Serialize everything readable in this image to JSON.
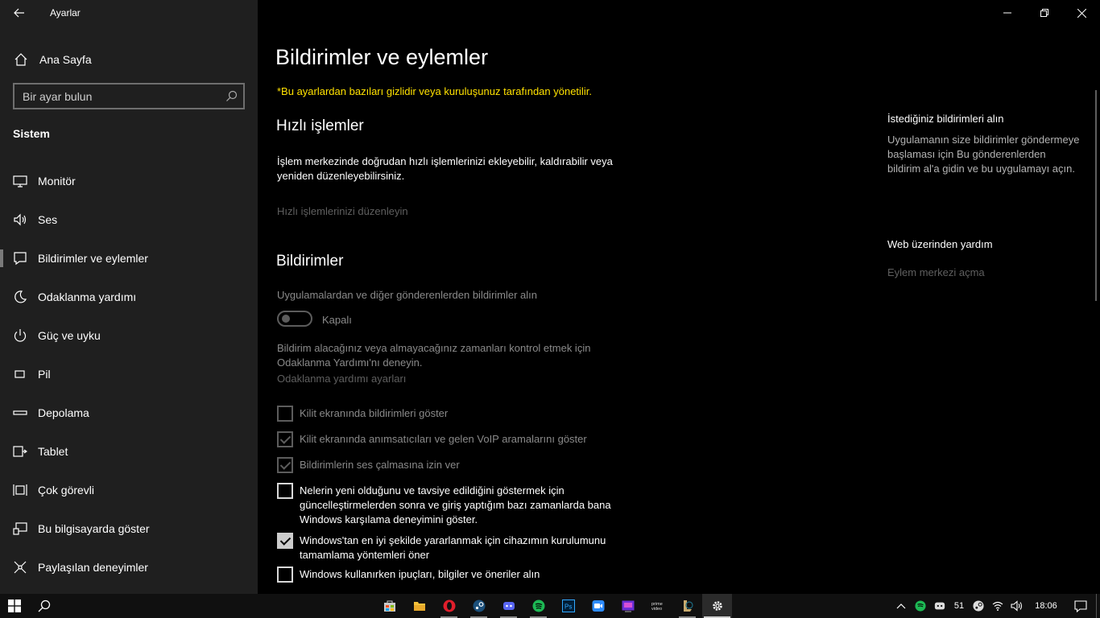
{
  "window": {
    "app_title": "Ayarlar"
  },
  "sidebar": {
    "home_label": "Ana Sayfa",
    "search_placeholder": "Bir ayar bulun",
    "section": "Sistem",
    "items": [
      {
        "label": "Monitör",
        "icon": "monitor-icon"
      },
      {
        "label": "Ses",
        "icon": "speaker-icon"
      },
      {
        "label": "Bildirimler ve eylemler",
        "icon": "notification-icon",
        "selected": true
      },
      {
        "label": "Odaklanma yardımı",
        "icon": "moon-icon"
      },
      {
        "label": "Güç ve uyku",
        "icon": "power-icon"
      },
      {
        "label": "Pil",
        "icon": "battery-icon"
      },
      {
        "label": "Depolama",
        "icon": "storage-icon"
      },
      {
        "label": "Tablet",
        "icon": "tablet-icon"
      },
      {
        "label": "Çok görevli",
        "icon": "multitask-icon"
      },
      {
        "label": "Bu bilgisayarda göster",
        "icon": "project-icon"
      },
      {
        "label": "Paylaşılan deneyimler",
        "icon": "shared-experiences-icon"
      }
    ]
  },
  "main": {
    "title": "Bildirimler ve eylemler",
    "managed_note": "*Bu ayarlardan bazıları gizlidir veya kuruluşunuz tarafından yönetilir.",
    "quick_actions": {
      "heading": "Hızlı işlemler",
      "description": "İşlem merkezinde doğrudan hızlı işlemlerinizi ekleyebilir, kaldırabilir veya yeniden düzenleyebilirsiniz.",
      "edit_link": "Hızlı işlemlerinizi düzenleyin"
    },
    "notifications": {
      "heading": "Bildirimler",
      "get_label": "Uygulamalardan ve diğer gönderenlerden bildirimler alın",
      "toggle_state": "Kapalı",
      "focus_text": "Bildirim alacağınız veya almayacağınız zamanları kontrol etmek için Odaklanma Yardımı'nı deneyin.",
      "focus_link": "Odaklanma yardımı ayarları",
      "checkboxes": [
        {
          "label": "Kilit ekranında bildirimleri göster",
          "checked": false,
          "enabled": false
        },
        {
          "label": "Kilit ekranında anımsatıcıları ve gelen VoIP aramalarını göster",
          "checked": true,
          "enabled": false
        },
        {
          "label": "Bildirimlerin ses çalmasına izin ver",
          "checked": true,
          "enabled": false
        },
        {
          "label": "Nelerin yeni olduğunu ve tavsiye edildiğini göstermek için güncelleştirmelerden sonra ve giriş yaptığım bazı zamanlarda bana Windows karşılama deneyimini göster.",
          "checked": false,
          "enabled": true
        },
        {
          "label": "Windows'tan en iyi şekilde yararlanmak için cihazımın kurulumunu tamamlama yöntemleri öner",
          "checked": true,
          "enabled": true
        },
        {
          "label": "Windows kullanırken ipuçları, bilgiler ve öneriler alın",
          "checked": false,
          "enabled": true
        }
      ]
    }
  },
  "right_panel": {
    "help_title": "İstediğiniz bildirimleri alın",
    "help_text": "Uygulamanın size bildirimler göndermeye başlaması için Bu gönderenlerden bildirim al'a gidin ve bu uygulamayı açın.",
    "web_help_title": "Web üzerinden yardım",
    "web_help_link": "Eylem merkezi açma"
  },
  "taskbar": {
    "apps": [
      "store-icon",
      "file-explorer-icon",
      "opera-icon",
      "steam-icon",
      "discord-icon",
      "spotify-icon",
      "photoshop-icon",
      "zoom-icon",
      "app-icon",
      "prime-video-icon",
      "league-icon",
      "settings-icon"
    ],
    "tray_badge": "51",
    "time": "18:06"
  },
  "colors": {
    "sidebar_bg": "#1f1f1f",
    "main_bg": "#000000",
    "managed_note": "#ffe100",
    "taskbar_bg": "#101010"
  }
}
